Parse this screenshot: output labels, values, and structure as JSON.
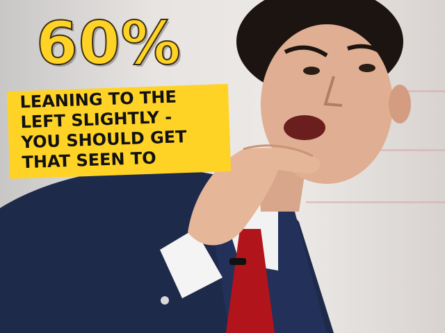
{
  "headline": "60%",
  "caption": [
    "LEANING TO THE",
    "LEFT SLIGHTLY -",
    "YOU SHOULD GET",
    "THAT SEEN TO"
  ],
  "colors": {
    "banner_yellow": "#ffd326",
    "text_dark": "#111111",
    "suit_navy": "#1d2a4a",
    "tie_red": "#b2141b",
    "background": "#e7e4e2"
  }
}
